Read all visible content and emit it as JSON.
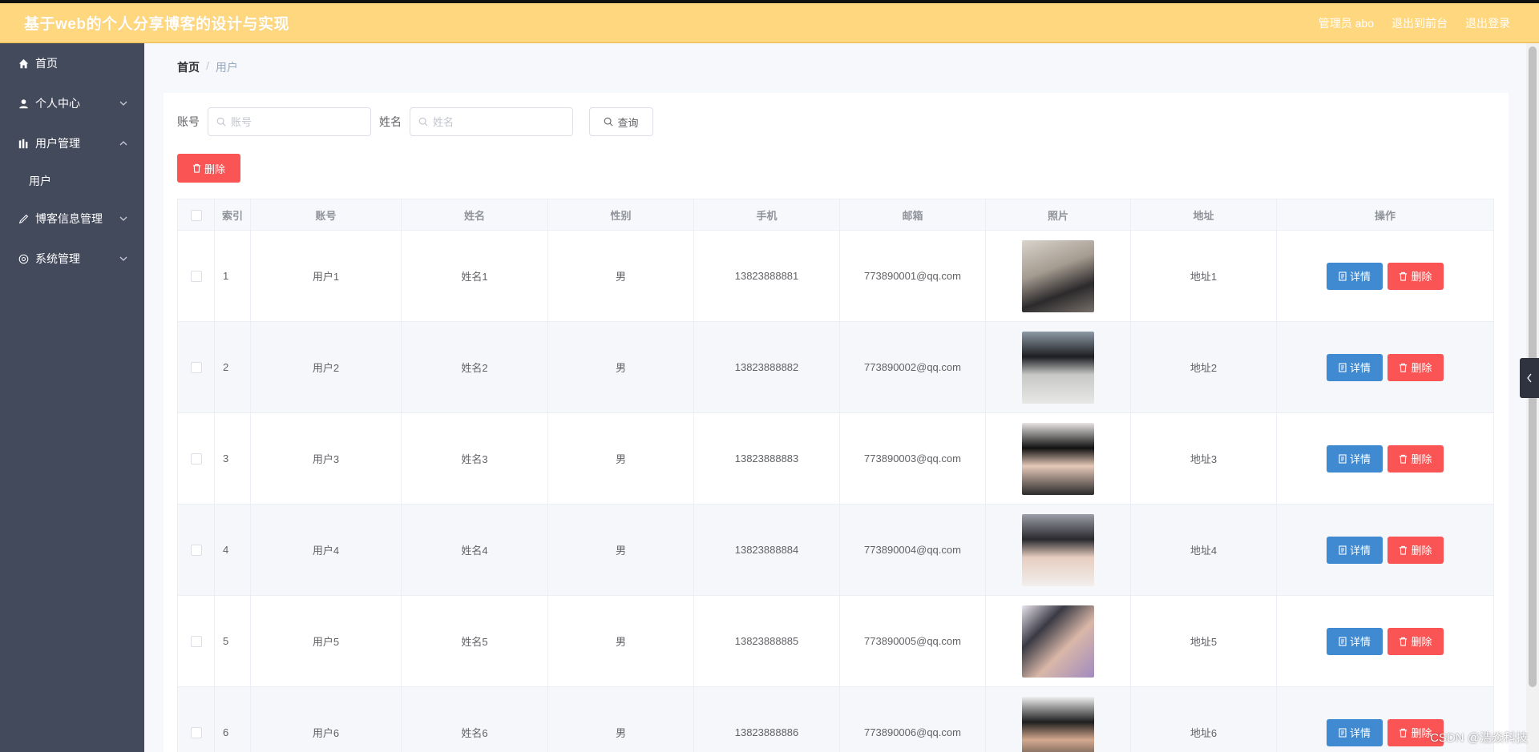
{
  "header": {
    "title": "基于web的个人分享博客的设计与实现",
    "user": "管理员 abo",
    "to_front": "退出到前台",
    "logout": "退出登录"
  },
  "sidebar": {
    "items": [
      {
        "label": "首页",
        "icon": "home-icon"
      },
      {
        "label": "个人中心",
        "icon": "user-icon"
      },
      {
        "label": "用户管理",
        "icon": "users-icon"
      },
      {
        "label": "博客信息管理",
        "icon": "blog-icon"
      },
      {
        "label": "系统管理",
        "icon": "system-icon"
      }
    ],
    "subitems": {
      "user": "用户"
    }
  },
  "breadcrumb": {
    "home": "首页",
    "sep": "/",
    "current": "用户"
  },
  "search": {
    "account_label": "账号",
    "account_placeholder": "账号",
    "name_label": "姓名",
    "name_placeholder": "姓名",
    "query_label": "查询"
  },
  "actions": {
    "batch_delete": "删除"
  },
  "table": {
    "headers": [
      "",
      "索引",
      "账号",
      "姓名",
      "性别",
      "手机",
      "邮箱",
      "照片",
      "地址",
      "操作"
    ],
    "rows": [
      {
        "index": "1",
        "account": "用户1",
        "name": "姓名1",
        "gender": "男",
        "phone": "13823888881",
        "email": "773890001@qq.com",
        "address": "地址1"
      },
      {
        "index": "2",
        "account": "用户2",
        "name": "姓名2",
        "gender": "男",
        "phone": "13823888882",
        "email": "773890002@qq.com",
        "address": "地址2"
      },
      {
        "index": "3",
        "account": "用户3",
        "name": "姓名3",
        "gender": "男",
        "phone": "13823888883",
        "email": "773890003@qq.com",
        "address": "地址3"
      },
      {
        "index": "4",
        "account": "用户4",
        "name": "姓名4",
        "gender": "男",
        "phone": "13823888884",
        "email": "773890004@qq.com",
        "address": "地址4"
      },
      {
        "index": "5",
        "account": "用户5",
        "name": "姓名5",
        "gender": "男",
        "phone": "13823888885",
        "email": "773890005@qq.com",
        "address": "地址5"
      },
      {
        "index": "6",
        "account": "用户6",
        "name": "姓名6",
        "gender": "男",
        "phone": "13823888886",
        "email": "773890006@qq.com",
        "address": "地址6"
      }
    ],
    "detail_label": "详情",
    "delete_label": "删除"
  },
  "watermark": "CSDN @浩焱科技",
  "colors": {
    "header_bg": "#ffd77e",
    "sidebar_bg": "#434a5c",
    "detail_btn": "#3f8ad0",
    "delete_btn": "#fb5454"
  }
}
